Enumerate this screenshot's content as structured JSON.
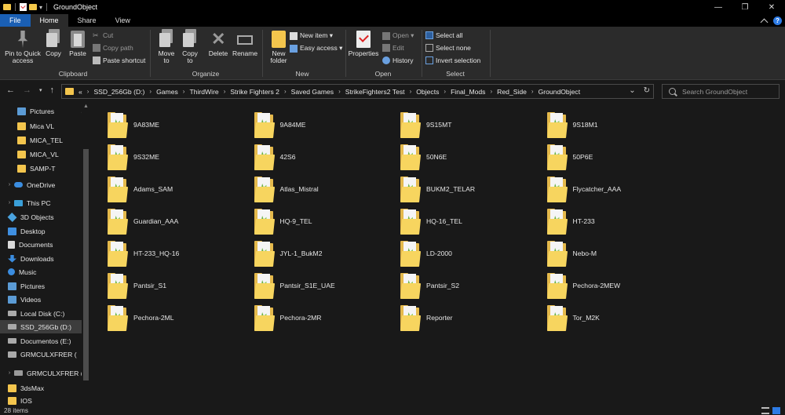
{
  "window": {
    "title": "GroundObject",
    "controls": {
      "minimize": "—",
      "maximize": "❐",
      "close": "✕"
    }
  },
  "tabs": [
    {
      "label": "File"
    },
    {
      "label": "Home"
    },
    {
      "label": "Share"
    },
    {
      "label": "View"
    }
  ],
  "ribbon": {
    "clipboard": {
      "label": "Clipboard",
      "pin": "Pin to Quick access",
      "copy": "Copy",
      "paste": "Paste",
      "cut": "Cut",
      "copy_path": "Copy path",
      "paste_shortcut": "Paste shortcut"
    },
    "organize": {
      "label": "Organize",
      "move_to": "Move to",
      "copy_to": "Copy to",
      "delete": "Delete",
      "rename": "Rename"
    },
    "new": {
      "label": "New",
      "new_folder": "New folder",
      "new_item": "New item ▾",
      "easy_access": "Easy access ▾"
    },
    "open": {
      "label": "Open",
      "properties": "Properties",
      "open": "Open ▾",
      "edit": "Edit",
      "history": "History"
    },
    "select": {
      "label": "Select",
      "select_all": "Select all",
      "select_none": "Select none",
      "invert": "Invert selection"
    }
  },
  "address": {
    "path": [
      "«",
      "SSD_256Gb (D:)",
      "Games",
      "ThirdWire",
      "Strike Fighters 2",
      "Saved Games",
      "StrikeFighters2 Test",
      "Objects",
      "Final_Mods",
      "Red_Side",
      "GroundObject"
    ],
    "search_placeholder": "Search GroundObject"
  },
  "nav": [
    {
      "label": "Pictures",
      "icon": "pictures-icon",
      "pinned": true
    },
    {
      "label": "Mica VL",
      "icon": "folder-icon"
    },
    {
      "label": "MICA_TEL",
      "icon": "folder-icon"
    },
    {
      "label": "MICA_VL",
      "icon": "folder-icon"
    },
    {
      "label": "SAMP-T",
      "icon": "folder-icon"
    },
    {
      "label": "OneDrive",
      "icon": "onedrive-icon"
    },
    {
      "label": "This PC",
      "icon": "this-pc-icon"
    },
    {
      "label": "3D Objects",
      "icon": "3d-objects-icon"
    },
    {
      "label": "Desktop",
      "icon": "desktop-icon"
    },
    {
      "label": "Documents",
      "icon": "documents-icon"
    },
    {
      "label": "Downloads",
      "icon": "downloads-icon"
    },
    {
      "label": "Music",
      "icon": "music-icon"
    },
    {
      "label": "Pictures",
      "icon": "pictures-icon"
    },
    {
      "label": "Videos",
      "icon": "videos-icon"
    },
    {
      "label": "Local Disk (C:)",
      "icon": "disk-icon"
    },
    {
      "label": "SSD_256Gb (D:)",
      "icon": "disk-icon",
      "selected": true
    },
    {
      "label": "Documentos (E:)",
      "icon": "disk-icon"
    },
    {
      "label": "GRMCULXFRER (",
      "icon": "network-drive-icon"
    },
    {
      "label": "GRMCULXFRER (G",
      "icon": "usb-drive-icon"
    },
    {
      "label": "3dsMax",
      "icon": "folder-icon"
    },
    {
      "label": "IOS",
      "icon": "folder-icon"
    }
  ],
  "folders": [
    "9A83ME",
    "9A84ME",
    "9S15MT",
    "9S18M1",
    "9S32ME",
    "42S6",
    "50N6E",
    "50P6E",
    "Adams_SAM",
    "Atlas_Mistral",
    "BUKM2_TELAR",
    "Flycatcher_AAA",
    "Guardian_AAA",
    "HQ-9_TEL",
    "HQ-16_TEL",
    "HT-233",
    "HT-233_HQ-16",
    "JYL-1_BukM2",
    "LD-2000",
    "Nebo-M",
    "Pantsir_S1",
    "Pantsir_S1E_UAE",
    "Pantsir_S2",
    "Pechora-2MEW",
    "Pechora-2ML",
    "Pechora-2MR",
    "Reporter",
    "Tor_M2K"
  ],
  "status": {
    "count": "28 items"
  },
  "colors": {
    "accent": "#1a5fb4",
    "folder": "#f3c54d",
    "background": "#191919",
    "ribbon": "#2b2b2b"
  }
}
